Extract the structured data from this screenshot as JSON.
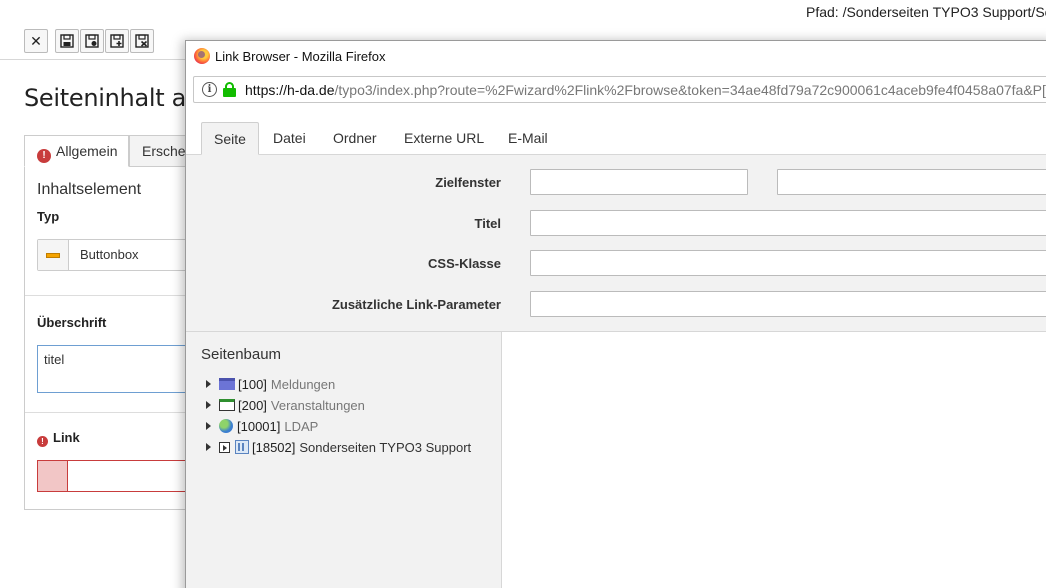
{
  "backend": {
    "path_label": "Pfad: /Sonderseiten TYPO3 Support/Se",
    "toolbar": {
      "close_glyph": "✕"
    },
    "heading": "Seiteninhalt au",
    "tabs": [
      {
        "label": "Allgemein",
        "error": "!"
      },
      {
        "label": "Ersche"
      }
    ],
    "section_title": "Inhaltselement",
    "typ_label": "Typ",
    "typ_value": "Buttonbox",
    "ueberschrift_label": "Überschrift",
    "ueberschrift_value": "titel",
    "link_label": "Link",
    "link_error": "!"
  },
  "popup": {
    "window_title": "Link Browser - Mozilla Firefox",
    "url_host": "https://h-da.de",
    "url_rest": "/typo3/index.php?route=%2Fwizard%2Flink%2Fbrowse&token=34ae48fd79a72c900061c4aceb9fe4f0458a07fa&P[ta",
    "tabs": [
      "Seite",
      "Datei",
      "Ordner",
      "Externe URL",
      "E-Mail"
    ],
    "form": {
      "zielfenster_label": "Zielfenster",
      "titel_label": "Titel",
      "css_label": "CSS-Klasse",
      "params_label": "Zusätzliche Link-Parameter"
    },
    "tree": {
      "title": "Seitenbaum",
      "items": [
        {
          "id": "[100]",
          "name": "Meldungen"
        },
        {
          "id": "[200]",
          "name": "Veranstaltungen"
        },
        {
          "id": "[10001]",
          "name": "LDAP"
        },
        {
          "id": "[18502]",
          "name": "Sonderseiten TYPO3 Support"
        }
      ]
    }
  }
}
